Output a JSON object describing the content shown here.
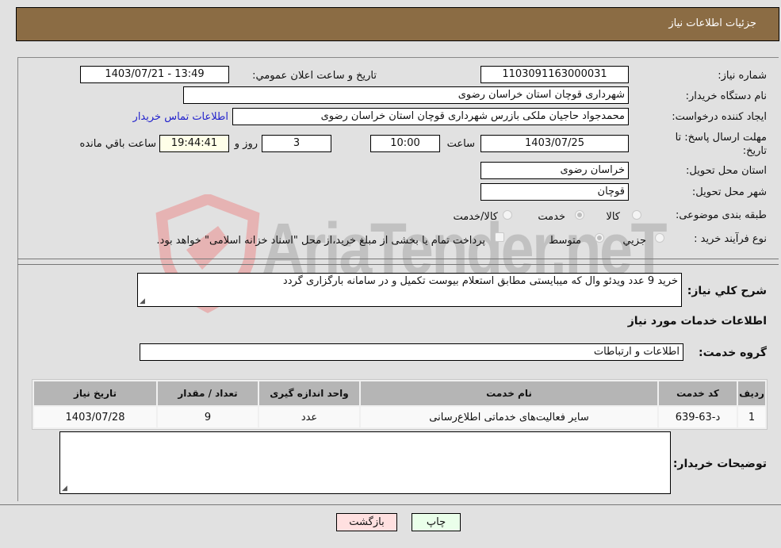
{
  "header": {
    "title": "جزئيات اطلاعات نياز"
  },
  "form": {
    "need_number": {
      "label": "شماره نیاز:",
      "value": "1103091163000031"
    },
    "announce_datetime": {
      "label": "تاريخ و ساعت اعلان عمومي:",
      "value": "1403/07/21 - 13:49"
    },
    "buyer_org": {
      "label": "نام دستگاه خريدار:",
      "value": "شهرداری قوچان استان خراسان رضوی"
    },
    "requester": {
      "label": "ايجاد کننده درخواست:",
      "value": "محمدجواد حاجیان ملکی بازرس شهرداری قوچان استان خراسان رضوی"
    },
    "buyer_contact_link": "اطلاعات تماس خريدار",
    "deadline": {
      "label": "مهلت ارسال پاسخ: تا تاريخ:",
      "date": "1403/07/25",
      "time_label": "ساعت",
      "time": "10:00",
      "days": "3",
      "days_label": "روز و",
      "remaining": "19:44:41",
      "remaining_label": "ساعت باقي مانده"
    },
    "delivery_province": {
      "label": "استان محل تحويل:",
      "value": "خراسان رضوی"
    },
    "delivery_city": {
      "label": "شهر محل تحويل:",
      "value": "قوچان"
    },
    "category": {
      "label": "طبقه بندی موضوعی:",
      "options": [
        "کالا",
        "خدمت",
        "کالا/خدمت"
      ],
      "selected": "خدمت"
    },
    "process_type": {
      "label": "نوع فرآيند خريد :",
      "options": [
        "جزيي",
        "متوسط"
      ],
      "selected": "متوسط",
      "treasury_note": "پرداخت تمام يا بخشی از مبلغ خريد،از محل \"اسناد خزانه اسلامی\" خواهد بود.",
      "treasury_checked": false
    },
    "description": {
      "label": "شرح کلي نياز:",
      "value": "خريد 9 عدد ويدئو وال که ميبايستی مطابق استعلام بيوست تکميل و در سامانه بارگزاری گردد"
    }
  },
  "services": {
    "section_title": "اطلاعات خدمات مورد نياز",
    "group_label": "گروه خدمت:",
    "group_value": "اطلاعات و ارتباطات",
    "table": {
      "headers": [
        "رديف",
        "کد خدمت",
        "نام خدمت",
        "واحد اندازه گيری",
        "تعداد / مقدار",
        "تاريخ نياز"
      ],
      "rows": [
        [
          "1",
          "د-63-639",
          "ساير فعاليت‌های خدماتی اطلاع‌رسانی",
          "عدد",
          "9",
          "1403/07/28"
        ]
      ]
    }
  },
  "buyer_notes": {
    "label": "توضيحات خريدار:",
    "value": ""
  },
  "buttons": {
    "print": "چاپ",
    "back": "بازگشت"
  },
  "watermark": {
    "text": "AriaTender.neT"
  },
  "colors": {
    "header_bg": "#8b6c44",
    "print_bg": "#eaffea",
    "back_bg": "#ffe0e0",
    "link": "#2222cc"
  }
}
